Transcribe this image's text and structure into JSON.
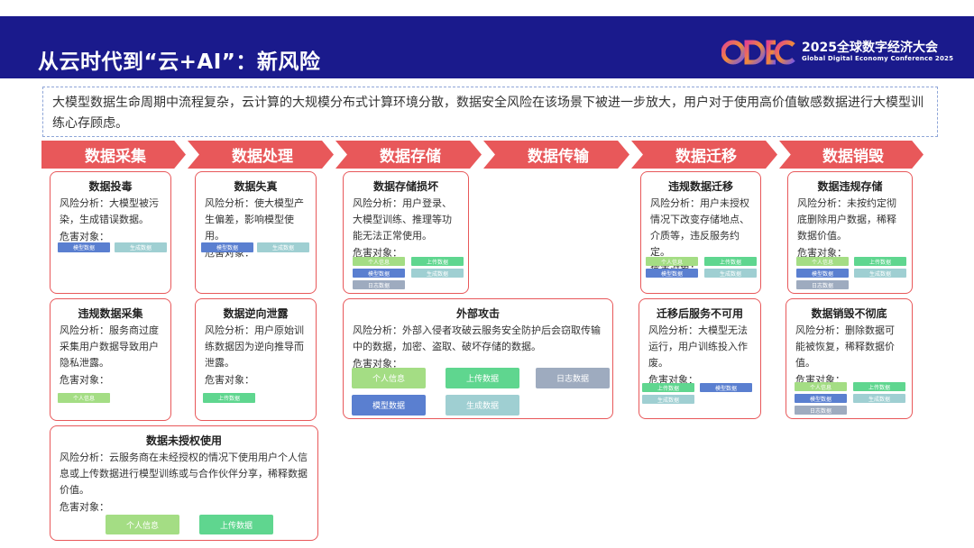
{
  "header": {
    "title": "从云时代到“云+AI”：新风险",
    "conf_cn": "2025全球数字经济大会",
    "conf_en": "Global Digital Economy Conference 2025",
    "logo_text": "GDEC",
    "colors": {
      "bar": "#1a1a8c",
      "logo_gradient": [
        "#e2438f",
        "#f08a3a",
        "#7a58e0"
      ]
    }
  },
  "intro": "大模型数据生命周期中流程复杂，云计算的大规模分布式计算环境分散，数据安全风险在该场景下被进一步放大，用户对于使用高价值敏感数据进行大模型训练心存顾虑。",
  "stages": [
    "数据采集",
    "数据处理",
    "数据存储",
    "数据传输",
    "数据迁移",
    "数据销毁"
  ],
  "tags": {
    "personal": "个人信息",
    "upload": "上传数据",
    "model": "模型数据",
    "generated": "生成数据",
    "log": "日志数据"
  },
  "cards": {
    "poison": {
      "title": "数据投毒",
      "text": "风险分析：大模型被污染，生成错误数据。",
      "target": "危害对象："
    },
    "illegal_collect": {
      "title": "违规数据采集",
      "text": "风险分析：服务商过度采集用户数据导致用户隐私泄露。",
      "target": "危害对象："
    },
    "unauthorized": {
      "title": "数据未授权使用",
      "text": "风险分析：云服务商在未经授权的情况下使用用户个人信息或上传数据进行模型训练或与合作伙伴分享，稀释数据价值。",
      "target": "危害对象："
    },
    "distortion": {
      "title": "数据失真",
      "text": "风险分析：使大模型产生偏差，影响模型使用。",
      "target": "危害对象："
    },
    "reverse_leak": {
      "title": "数据逆向泄露",
      "text": "风险分析：用户原始训练数据因为逆向推导而泄露。",
      "target": "危害对象："
    },
    "storage_damage": {
      "title": "数据存储损坏",
      "text": "风险分析：用户登录、大模型训练、推理等功能无法正常使用。",
      "target": "危害对象："
    },
    "external_attack": {
      "title": "外部攻击",
      "text": "风险分析：外部入侵者攻破云服务安全防护后会窃取传输中的数据，加密、盗取、破坏存储的数据。",
      "target": "危害对象："
    },
    "illegal_migrate": {
      "title": "违规数据迁移",
      "text": "风险分析：用户未授权情况下改变存储地点、介质等，违反服务约定。",
      "target": "危害对象："
    },
    "post_migrate": {
      "title": "迁移后服务不可用",
      "text": "风险分析：大模型无法运行，用户训练投入作废。",
      "target": "危害对象："
    },
    "illegal_store": {
      "title": "数据违规存储",
      "text": "风险分析：未按约定彻底删除用户数据，稀释数据价值。",
      "target": "危害对象："
    },
    "incomplete_destroy": {
      "title": "数据销毁不彻底",
      "text": "风险分析：删除数据可能被恢复，稀释数据价值。",
      "target": "危害对象："
    }
  },
  "colors": {
    "accent": "#e8585a",
    "intro_border": "#8fa6d8"
  }
}
